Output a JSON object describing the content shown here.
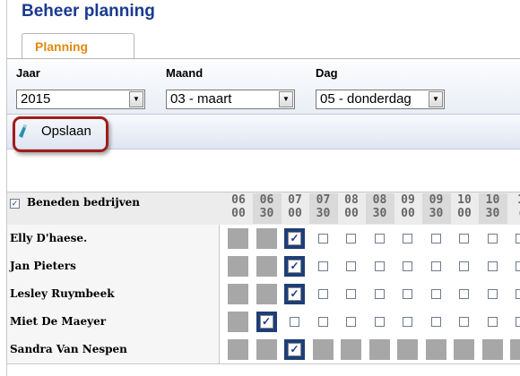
{
  "page": {
    "title": "Beheer planning"
  },
  "tabs": [
    {
      "label": "Planning"
    }
  ],
  "filters": {
    "year": {
      "label": "Jaar",
      "value": "2015"
    },
    "month": {
      "label": "Maand",
      "value": "03 - maart"
    },
    "day": {
      "label": "Dag",
      "value": "05 - donderdag"
    }
  },
  "toolbar": {
    "save_label": "Opslaan"
  },
  "grid": {
    "header_checkbox_label": "Beneden bedrijven",
    "header_checked": true,
    "slots": [
      {
        "h": "06",
        "m": "00"
      },
      {
        "h": "06",
        "m": "30"
      },
      {
        "h": "07",
        "m": "00"
      },
      {
        "h": "07",
        "m": "30"
      },
      {
        "h": "08",
        "m": "00"
      },
      {
        "h": "08",
        "m": "30"
      },
      {
        "h": "09",
        "m": "00"
      },
      {
        "h": "09",
        "m": "30"
      },
      {
        "h": "10",
        "m": "00"
      },
      {
        "h": "10",
        "m": "30"
      },
      {
        "h": "1",
        "m": "("
      }
    ],
    "cell_legend": {
      "blk": "unavailable",
      "sel": "checked",
      "open": "unchecked"
    },
    "rows": [
      {
        "name": "Elly D'haese.",
        "cells": [
          "blk",
          "blk",
          "sel",
          "open",
          "open",
          "open",
          "open",
          "open",
          "open",
          "open",
          "open"
        ]
      },
      {
        "name": "Jan Pieters",
        "cells": [
          "blk",
          "blk",
          "sel",
          "open",
          "open",
          "open",
          "open",
          "open",
          "open",
          "open",
          "open"
        ]
      },
      {
        "name": "Lesley Ruymbeek",
        "cells": [
          "blk",
          "blk",
          "sel",
          "open",
          "open",
          "open",
          "open",
          "open",
          "open",
          "open",
          "open"
        ]
      },
      {
        "name": "Miet De Maeyer",
        "cells": [
          "blk",
          "sel",
          "open",
          "open",
          "open",
          "open",
          "open",
          "open",
          "open",
          "open",
          "open"
        ]
      },
      {
        "name": "Sandra Van Nespen",
        "cells": [
          "blk",
          "blk",
          "sel",
          "blk",
          "blk",
          "blk",
          "blk",
          "blk",
          "blk",
          "blk",
          "blk"
        ]
      }
    ]
  },
  "colors": {
    "title": "#1a3a8f",
    "tab_text": "#e08a12",
    "selected_cell": "#1d3e78",
    "blocked_cell": "#a7a7a7",
    "save_highlight": "#a01c1c"
  }
}
